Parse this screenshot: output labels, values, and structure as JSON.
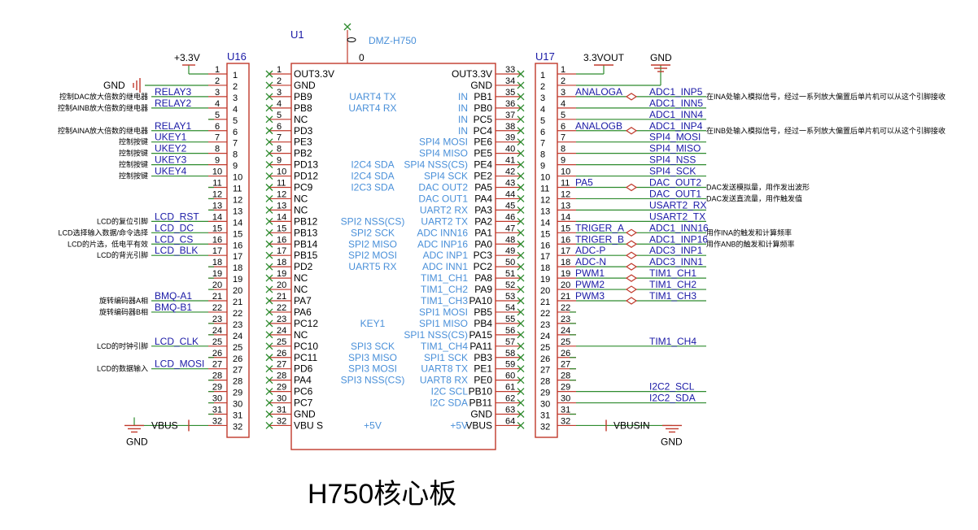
{
  "u1": {
    "designator": "U1",
    "part_name": "DMZ-H750",
    "part_value": "0",
    "left_pins": [
      {
        "num": "1",
        "name": "OUT3.3V",
        "func": ""
      },
      {
        "num": "2",
        "name": "GND",
        "func": ""
      },
      {
        "num": "3",
        "name": "PB9",
        "func": "UART4 TX"
      },
      {
        "num": "4",
        "name": "PB8",
        "func": "UART4 RX"
      },
      {
        "num": "5",
        "name": "NC",
        "func": ""
      },
      {
        "num": "6",
        "name": "PD3",
        "func": ""
      },
      {
        "num": "7",
        "name": "PE3",
        "func": ""
      },
      {
        "num": "8",
        "name": "PB2",
        "func": ""
      },
      {
        "num": "9",
        "name": "PD13",
        "func": "I2C4 SDA"
      },
      {
        "num": "10",
        "name": "PD12",
        "func": "I2C4 SDA"
      },
      {
        "num": "11",
        "name": "PC9",
        "func": "I2C3 SDA"
      },
      {
        "num": "12",
        "name": "NC",
        "func": ""
      },
      {
        "num": "13",
        "name": "NC",
        "func": ""
      },
      {
        "num": "14",
        "name": "PB12",
        "func": "SPI2 NSS(CS)"
      },
      {
        "num": "15",
        "name": "PB13",
        "func": "SPI2 SCK"
      },
      {
        "num": "16",
        "name": "PB14",
        "func": "SPI2 MISO"
      },
      {
        "num": "17",
        "name": "PB15",
        "func": "SPI2 MOSI"
      },
      {
        "num": "18",
        "name": "PD2",
        "func": "UART5 RX"
      },
      {
        "num": "19",
        "name": "NC",
        "func": ""
      },
      {
        "num": "20",
        "name": "NC",
        "func": ""
      },
      {
        "num": "21",
        "name": "PA7",
        "func": ""
      },
      {
        "num": "22",
        "name": "PA6",
        "func": ""
      },
      {
        "num": "23",
        "name": "PC12",
        "func": "KEY1"
      },
      {
        "num": "24",
        "name": "NC",
        "func": ""
      },
      {
        "num": "25",
        "name": "PC10",
        "func": "SPI3 SCK"
      },
      {
        "num": "26",
        "name": "PC11",
        "func": "SPI3 MISO"
      },
      {
        "num": "27",
        "name": "PD6",
        "func": "SPI3 MOSI"
      },
      {
        "num": "28",
        "name": "PA4",
        "func": "SPI3 NSS(CS)"
      },
      {
        "num": "29",
        "name": "PC6",
        "func": ""
      },
      {
        "num": "30",
        "name": "PC7",
        "func": ""
      },
      {
        "num": "31",
        "name": "GND",
        "func": ""
      },
      {
        "num": "32",
        "name": "VBU S",
        "func": "+5V"
      }
    ],
    "right_pins": [
      {
        "num": "33",
        "name": "OUT3.3V",
        "func": ""
      },
      {
        "num": "34",
        "name": "GND",
        "func": ""
      },
      {
        "num": "35",
        "name": "PB1",
        "func": "IN"
      },
      {
        "num": "36",
        "name": "PB0",
        "func": "IN"
      },
      {
        "num": "37",
        "name": "PC5",
        "func": "IN"
      },
      {
        "num": "38",
        "name": "PC4",
        "func": "IN"
      },
      {
        "num": "39",
        "name": "PE6",
        "func": "SPI4 MOSI"
      },
      {
        "num": "40",
        "name": "PE5",
        "func": "SPI4 MISO"
      },
      {
        "num": "41",
        "name": "PE4",
        "func": "SPI4 NSS(CS)"
      },
      {
        "num": "42",
        "name": "PE2",
        "func": "SPI4 SCK"
      },
      {
        "num": "43",
        "name": "PA5",
        "func": "DAC OUT2"
      },
      {
        "num": "44",
        "name": "PA4",
        "func": "DAC OUT1"
      },
      {
        "num": "45",
        "name": "PA3",
        "func": "UART2 RX"
      },
      {
        "num": "46",
        "name": "PA2",
        "func": "UART2 TX"
      },
      {
        "num": "47",
        "name": "PA1",
        "func": "ADC INN16"
      },
      {
        "num": "48",
        "name": "PA0",
        "func": "ADC INP16"
      },
      {
        "num": "49",
        "name": "PC3",
        "func": "ADC INP1"
      },
      {
        "num": "50",
        "name": "PC2",
        "func": "ADC INN1"
      },
      {
        "num": "51",
        "name": "PA8",
        "func": "TIM1_CH1"
      },
      {
        "num": "52",
        "name": "PA9",
        "func": "TIM1_CH2"
      },
      {
        "num": "53",
        "name": "PA10",
        "func": "TIM1_CH3"
      },
      {
        "num": "54",
        "name": "PB5",
        "func": "SPI1 MOSI"
      },
      {
        "num": "55",
        "name": "PB4",
        "func": "SPI1 MISO"
      },
      {
        "num": "56",
        "name": "PA15",
        "func": "SPI1 NSS(CS)"
      },
      {
        "num": "57",
        "name": "PA11",
        "func": "TIM1_CH4"
      },
      {
        "num": "58",
        "name": "PB3",
        "func": "SPI1 SCK"
      },
      {
        "num": "59",
        "name": "PE1",
        "func": "UART8 TX"
      },
      {
        "num": "60",
        "name": "PE0",
        "func": "UART8 RX"
      },
      {
        "num": "61",
        "name": "PB10",
        "func": "I2C SCL"
      },
      {
        "num": "62",
        "name": "PB11",
        "func": "I2C SDA"
      },
      {
        "num": "63",
        "name": "GND",
        "func": ""
      },
      {
        "num": "64",
        "name": "VBUS",
        "func": "+5V"
      }
    ]
  },
  "u16": {
    "designator": "U16",
    "power_label": "+3.3V",
    "gnd_label": "GND",
    "vbus_label": "VBUS",
    "bottom_gnd_label": "GND",
    "pin_numbers": [
      "1",
      "2",
      "3",
      "4",
      "5",
      "6",
      "7",
      "8",
      "9",
      "10",
      "11",
      "12",
      "13",
      "14",
      "15",
      "16",
      "17",
      "18",
      "19",
      "20",
      "21",
      "22",
      "23",
      "24",
      "25",
      "26",
      "27",
      "28",
      "29",
      "30",
      "31",
      "32"
    ],
    "nets": [
      {
        "pin": 3,
        "net": "RELAY3",
        "note": "控制DAC放大倍数的继电器"
      },
      {
        "pin": 4,
        "net": "RELAY2",
        "note": "控制AINB放大倍数的继电器"
      },
      {
        "pin": 6,
        "net": "RELAY1",
        "note": "控制AINA放大倍数的继电器"
      },
      {
        "pin": 7,
        "net": "UKEY1",
        "note": "控制按键"
      },
      {
        "pin": 8,
        "net": "UKEY2",
        "note": "控制按键"
      },
      {
        "pin": 9,
        "net": "UKEY3",
        "note": "控制按键"
      },
      {
        "pin": 10,
        "net": "UKEY4",
        "note": "控制按键"
      },
      {
        "pin": 14,
        "net": "LCD_RST",
        "note": "LCD的复位引脚"
      },
      {
        "pin": 15,
        "net": "LCD_DC",
        "note": "LCD选择输入数据/命令选择"
      },
      {
        "pin": 16,
        "net": "LCD_CS",
        "note": "LCD的片选，低电平有效"
      },
      {
        "pin": 17,
        "net": "LCD_BLK",
        "note": "LCD的背光引脚"
      },
      {
        "pin": 21,
        "net": "BMQ-A1",
        "note": "旋转编码器A相"
      },
      {
        "pin": 22,
        "net": "BMQ-B1",
        "note": "旋转编码器B相"
      },
      {
        "pin": 25,
        "net": "LCD_CLK",
        "note": "LCD的时钟引脚"
      },
      {
        "pin": 27,
        "net": "LCD_MOSI",
        "note": "LCD的数据输入"
      }
    ]
  },
  "u17": {
    "designator": "U17",
    "power_label": "3.3VOUT",
    "gnd_label": "GND",
    "vbus_label": "VBUSIN",
    "bottom_gnd_label": "GND",
    "pin_numbers": [
      "1",
      "2",
      "3",
      "4",
      "5",
      "6",
      "7",
      "8",
      "9",
      "10",
      "11",
      "12",
      "13",
      "14",
      "15",
      "16",
      "17",
      "18",
      "19",
      "20",
      "21",
      "22",
      "23",
      "24",
      "25",
      "26",
      "27",
      "28",
      "29",
      "30",
      "31",
      "32"
    ],
    "nets": [
      {
        "pin": 3,
        "local": "ANALOGA",
        "net": "ADC1_INP5",
        "note": "在INA处输入模拟信号，经过一系列放大偏置后单片机可以从这个引脚接收"
      },
      {
        "pin": 4,
        "local": "",
        "net": "ADC1_INN5",
        "note": ""
      },
      {
        "pin": 5,
        "local": "",
        "net": "ADC1_INN4",
        "note": ""
      },
      {
        "pin": 6,
        "local": "ANALOGB",
        "net": "ADC1_INP4",
        "note": "在INB处输入模拟信号，经过一系列放大偏置后单片机可以从这个引脚接收"
      },
      {
        "pin": 7,
        "local": "",
        "net": "SPI4_MOSI",
        "note": ""
      },
      {
        "pin": 8,
        "local": "",
        "net": "SPI4_MISO",
        "note": ""
      },
      {
        "pin": 9,
        "local": "",
        "net": "SPI4_NSS",
        "note": ""
      },
      {
        "pin": 10,
        "local": "",
        "net": "SPI4_SCK",
        "note": ""
      },
      {
        "pin": 11,
        "local": "PA5",
        "net": "DAC_OUT2",
        "note": "DAC发送模拟量，用作发出波形"
      },
      {
        "pin": 12,
        "local": "",
        "net": "DAC_OUT1",
        "note": "DAC发送直流量，用作触发值"
      },
      {
        "pin": 13,
        "local": "",
        "net": "USART2_RX",
        "note": ""
      },
      {
        "pin": 14,
        "local": "",
        "net": "USART2_TX",
        "note": ""
      },
      {
        "pin": 15,
        "local": "TRIGER_A",
        "net": "ADC1_INN16",
        "note": "用作INA的触发和计算频率"
      },
      {
        "pin": 16,
        "local": "TRIGER_B",
        "net": "ADC1_INP16",
        "note": "用作ANB的触发和计算频率"
      },
      {
        "pin": 17,
        "local": "ADC-P",
        "net": "ADC3_INP1",
        "note": ""
      },
      {
        "pin": 18,
        "local": "ADC-N",
        "net": "ADC3_INN1",
        "note": ""
      },
      {
        "pin": 19,
        "local": "PWM1",
        "net": "TIM1_CH1",
        "note": ""
      },
      {
        "pin": 20,
        "local": "PWM2",
        "net": "TIM1_CH2",
        "note": ""
      },
      {
        "pin": 21,
        "local": "PWM3",
        "net": "TIM1_CH3",
        "note": ""
      },
      {
        "pin": 25,
        "local": "",
        "net": "TIM1_CH4",
        "note": ""
      },
      {
        "pin": 29,
        "local": "",
        "net": "I2C2_SCL",
        "note": ""
      },
      {
        "pin": 30,
        "local": "",
        "net": "I2C2_SDA",
        "note": ""
      }
    ]
  },
  "board_title": "H750核心板",
  "colors": {
    "wire": "#2e8b2e",
    "body": "#c0392b",
    "net_label": "#1a1aa6",
    "pin_func": "#4a90d9",
    "text": "#000000",
    "noconnect": "#2e8b2e"
  }
}
